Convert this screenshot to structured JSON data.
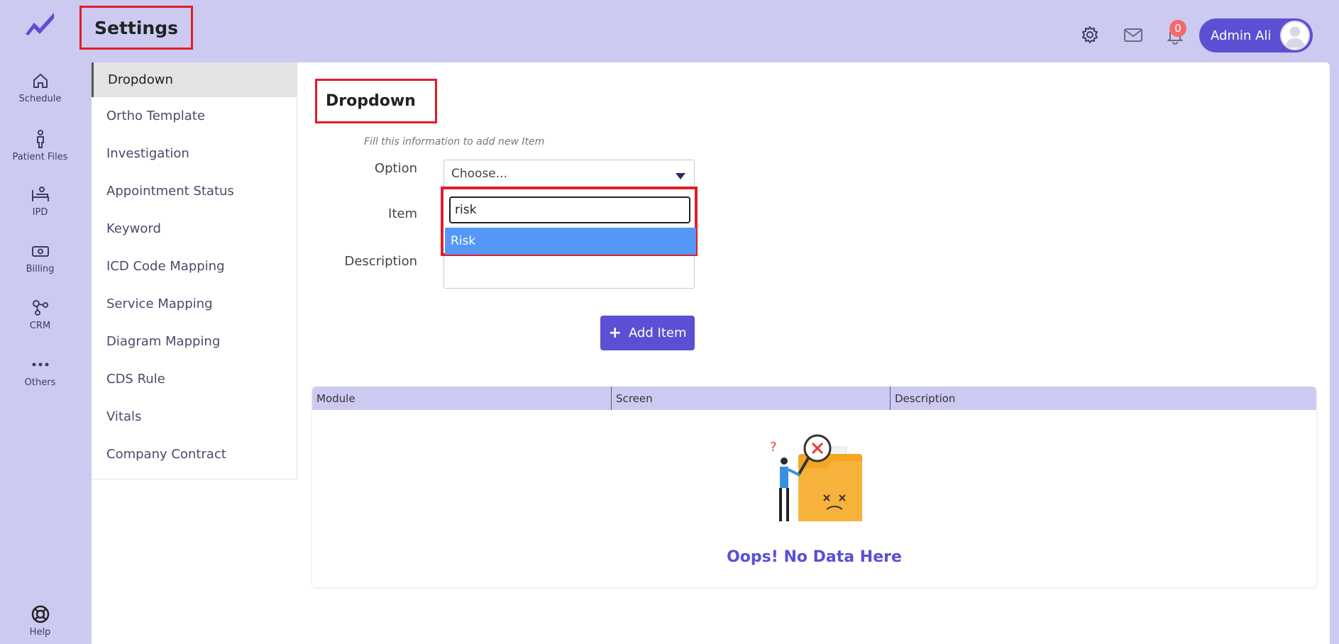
{
  "header": {
    "page_title": "Settings",
    "notification_count": "0",
    "user_name": "Admin Ali"
  },
  "rail": {
    "items": [
      {
        "label": "Schedule",
        "icon": "home-icon"
      },
      {
        "label": "Patient Files",
        "icon": "person-icon"
      },
      {
        "label": "IPD",
        "icon": "bed-icon"
      },
      {
        "label": "Billing",
        "icon": "billing-icon"
      },
      {
        "label": "CRM",
        "icon": "crm-icon"
      },
      {
        "label": "Others",
        "icon": "more-icon"
      }
    ],
    "help_label": "Help"
  },
  "submenu": {
    "items": [
      "Dropdown",
      "Ortho Template",
      "Investigation",
      "Appointment Status",
      "Keyword",
      "ICD Code Mapping",
      "Service Mapping",
      "Diagram Mapping",
      "CDS Rule",
      "Vitals",
      "Company Contract"
    ],
    "active": "Dropdown"
  },
  "form": {
    "section_title": "Dropdown",
    "hint": "Fill this information to add new Item",
    "option_label": "Option",
    "option_placeholder": "Choose...",
    "item_label": "Item",
    "description_label": "Description",
    "search_value": "risk",
    "highlighted_option": "Risk",
    "add_button_label": "Add Item"
  },
  "table": {
    "columns": [
      "Module",
      "Screen",
      "Description"
    ],
    "empty_message": "Oops! No Data Here"
  },
  "colors": {
    "accent": "#5b4fd3",
    "background": "#cdcaf1",
    "highlight": "#e11d2a",
    "option_selected": "#5597f7"
  }
}
